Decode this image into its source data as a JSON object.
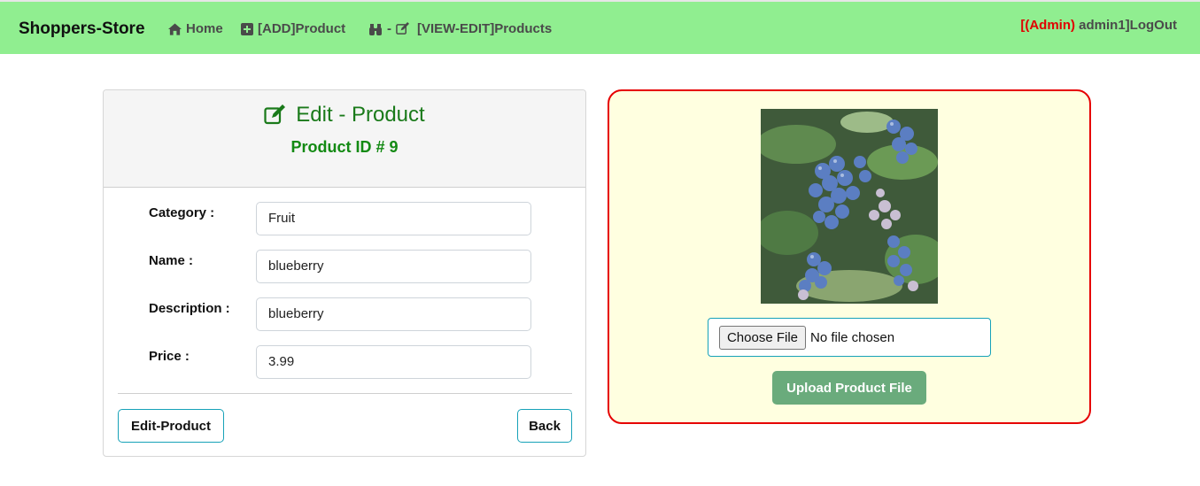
{
  "navbar": {
    "brand": "Shoppers-Store",
    "home": "Home",
    "add_product": "[ADD]Product",
    "view_edit_sep": "-",
    "view_edit": "[VIEW-EDIT]Products",
    "user_bracket_open": "[",
    "user_role": "(Admin)",
    "user_name": " admin1]",
    "logout": "LogOut"
  },
  "card": {
    "title": "Edit - Product",
    "subtitle": "Product ID # 9",
    "fields": [
      {
        "label": "Category :",
        "value": "Fruit"
      },
      {
        "label": "Name :",
        "value": "blueberry"
      },
      {
        "label": "Description :",
        "value": "blueberry"
      },
      {
        "label": "Price :",
        "value": "3.99"
      }
    ],
    "edit_button": "Edit-Product",
    "back_button": "Back"
  },
  "upload": {
    "choose_button": "Choose File",
    "file_status": "No file chosen",
    "upload_button": "Upload Product File"
  },
  "colors": {
    "navbar": "#90ee90",
    "panel_bg": "#ffffe0",
    "panel_border": "#e60000",
    "title_green": "#1a7a1a",
    "upload_button": "#6aab7c",
    "outline_accent": "#17a2b8"
  },
  "icons": {
    "home": "home-icon",
    "add": "plus-square-icon",
    "view": "binoculars-icon",
    "edit": "edit-icon"
  }
}
